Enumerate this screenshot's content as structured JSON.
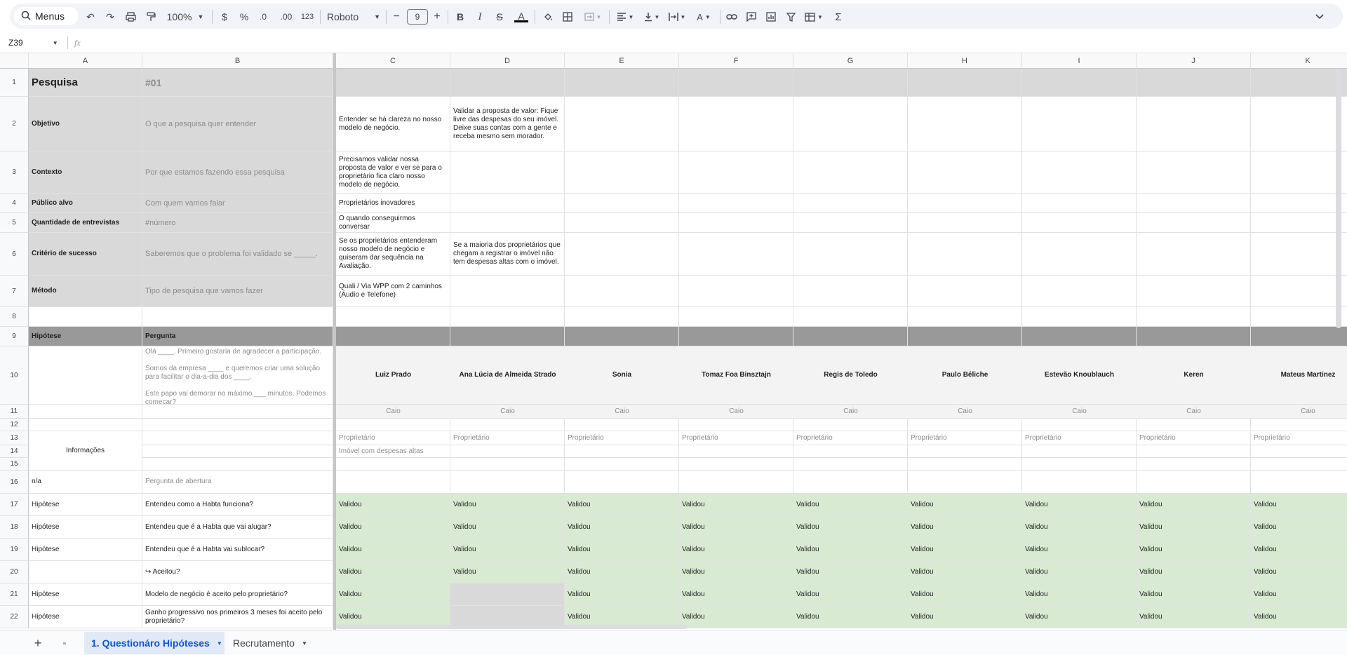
{
  "toolbar": {
    "menus_label": "Menus",
    "zoom": "100%",
    "currency": "$",
    "percent": "%",
    "dec_less": ".0",
    "dec_more": ".00",
    "format_123": "123",
    "font": "Roboto",
    "font_size": "9",
    "minus": "−",
    "plus": "+",
    "bold": "B",
    "italic": "I",
    "strike": "S",
    "text_color": "A"
  },
  "formula": {
    "cell_ref": "Z39",
    "fx": "fx"
  },
  "columns": [
    "A",
    "B",
    "C",
    "D",
    "E",
    "F",
    "G",
    "H",
    "I",
    "J",
    "K"
  ],
  "row_numbers": [
    "1",
    "2",
    "3",
    "4",
    "5",
    "6",
    "7",
    "8",
    "9",
    "10",
    "11",
    "12",
    "13",
    "14",
    "15",
    "16",
    "17",
    "18",
    "19",
    "20",
    "21",
    "22"
  ],
  "cells": {
    "A1": "Pesquisa",
    "B1": "#01",
    "A2": "Objetivo",
    "B2": "O que a pesquisa quer entender",
    "C2": "Entender se há clareza no nosso modelo de negócio.",
    "D2": "Validar a proposta de valor: Fique livre das despesas do seu imóvel. Deixe suas contas com a gente e receba mesmo sem morador.",
    "A3": "Contexto",
    "B3": "Por que estamos fazendo essa pesquisa",
    "C3": "Precisamos validar nossa proposta de valor e ver se para o proprietário fica claro nosso modelo de negócio.",
    "A4": "Público alvo",
    "B4": "Com quem vamos falar",
    "C4": "Proprietários inovadores",
    "A5": "Quantidade de entrevistas",
    "B5": "#número",
    "C5": "O quando conseguirmos conversar",
    "A6": "Critério de sucesso",
    "B6": "Saberemos que o problema foi validado se _____.",
    "C6": "Se os proprietários entenderam nosso modelo de negócio e quiseram dar sequência na Avaliação.",
    "D6": "Se a maioria dos proprietários que chegam a registrar o imóvel não tem despesas altas com o imóvel.",
    "A7": "Método",
    "B7": "Tipo de pesquisa que vamos fazer",
    "C7": "Quali / Via WPP com 2 caminhos (Áudio e Telefone)",
    "A9": "Hipótese",
    "B9": "Pergunta",
    "B10": "Olá ____. Primeiro gostaria de agradecer a participação.\n\nSomos da empresa ____ e queremos criar uma solução para facilitar o dia-a-dia dos ____.\n\nEste papo vai demorar no máximo ___ minutos. Podemos começar?",
    "A13": "Informações",
    "C14": "Imóvel com despesas altas",
    "A16": "n/a",
    "B16": "Pergunta de abertura",
    "B17": "Entendeu como a Habta funciona?",
    "B18": "Entendeu que é a Habta que vai alugar?",
    "B19": "Entendeu que é a Habta vai sublocar?",
    "B20": "↪ Aceitou?",
    "B21": "Modelo de negócio é aceito pelo proprietário?",
    "B22": "Ganho progressivo nos primeiros 3 meses foi aceito pelo proprietário?",
    "hip": "Hipótese"
  },
  "interviewees": [
    "Luiz Prado",
    "Ana Lúcia de Almeida Strado",
    "Sonia",
    "Tomaz Foa Binsztajn",
    "Regis de Toledo",
    "Paulo Béliche",
    "Estevão Knoublauch",
    "Keren",
    "Mateus Martinez"
  ],
  "interviewer": "Caio",
  "role": "Proprietário",
  "result": "Validou",
  "sheets": {
    "active": "1. Questionáro Hipóteses",
    "other": "Recrutamento"
  }
}
